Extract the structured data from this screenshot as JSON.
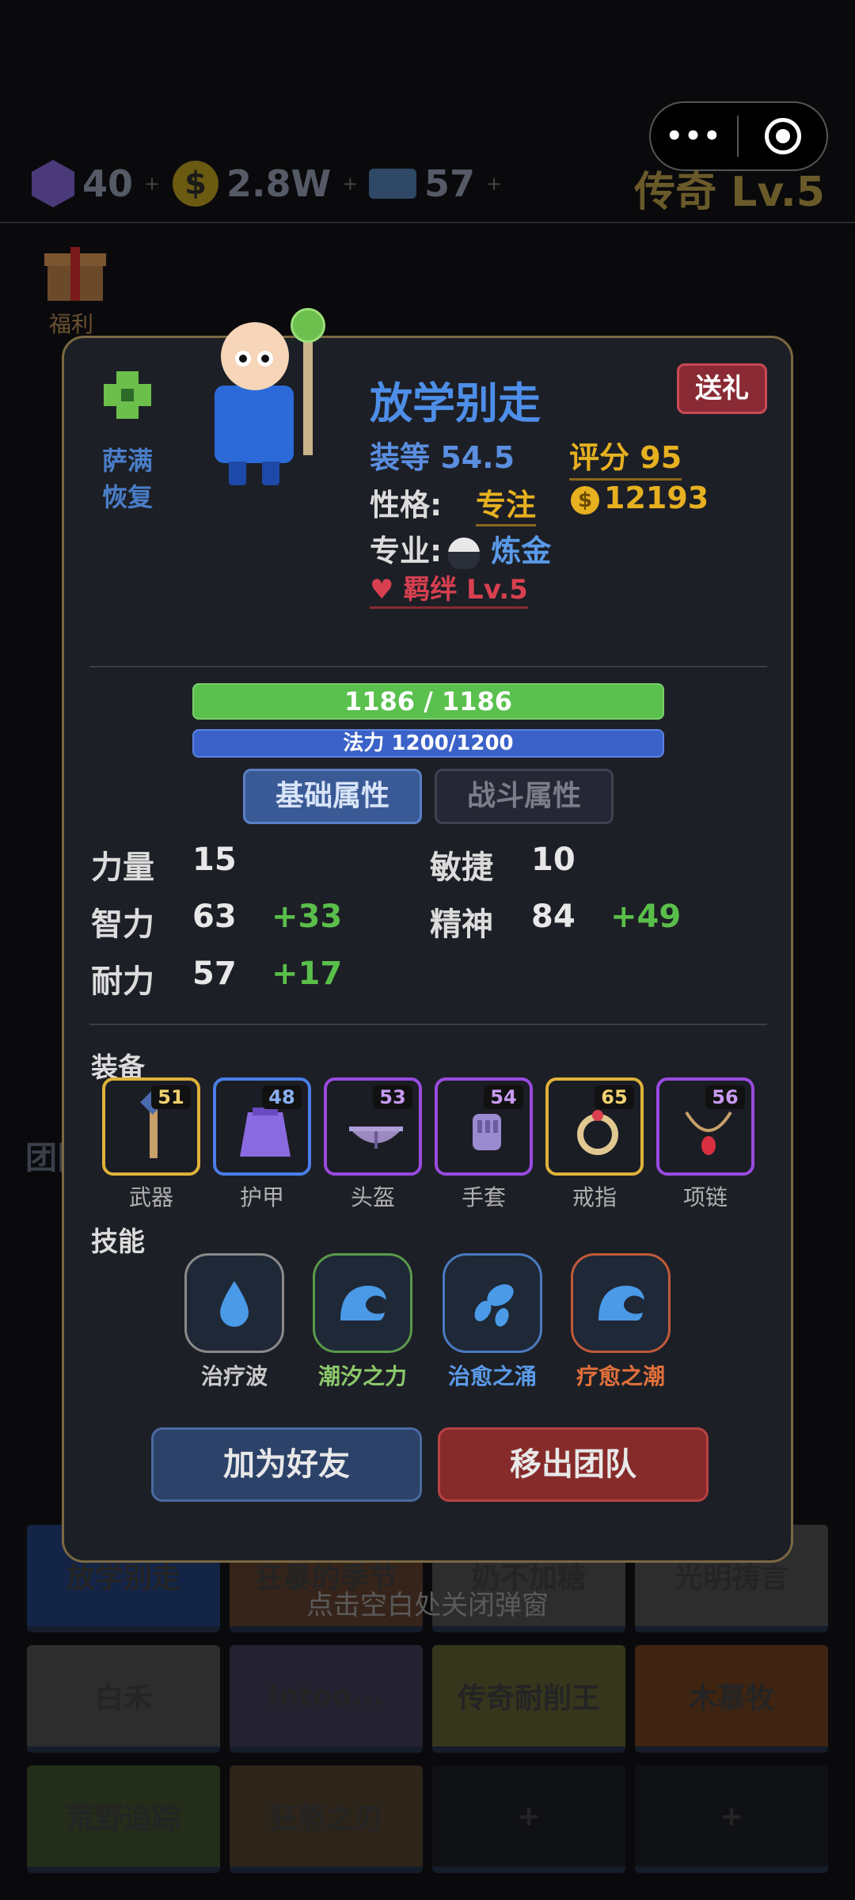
{
  "top": {
    "gems": "40",
    "gold": "2.8W",
    "tickets": "57",
    "plus": "+",
    "coin_glyph": "$",
    "rank": "传奇 Lv.5",
    "capsule_more": "•••"
  },
  "background": {
    "welfare_label": "福利",
    "hint": "点击空白处关闭弹窗",
    "team_header": "团队",
    "tiles": [
      {
        "label": "放学别走",
        "color": "#1b3a78"
      },
      {
        "label": "狂暴的季节",
        "color": "#5a3a26"
      },
      {
        "label": "奶不加糖",
        "color": "#4a4a4a"
      },
      {
        "label": "光明祷言",
        "color": "#4a4a4a"
      },
      {
        "label": "白禾",
        "color": "#4a4a4a"
      },
      {
        "label": "Intoo...",
        "color": "#3a3550"
      },
      {
        "label": "传奇耐削王",
        "color": "#5a5a2a"
      },
      {
        "label": "木慕牧",
        "color": "#6a3a16"
      },
      {
        "label": "荒野追踪",
        "color": "#3a4a26"
      },
      {
        "label": "狂怒之刃",
        "color": "#4a3a26"
      },
      {
        "label": "+",
        "color": "#16181e"
      },
      {
        "label": "+",
        "color": "#16181e"
      }
    ]
  },
  "profile": {
    "class_skill": "萨满\n恢复",
    "class_skill_line1": "萨满",
    "class_skill_line2": "恢复",
    "name": "放学别走",
    "gift_button": "送礼",
    "gear_level_label": "装等",
    "gear_level": "54.5",
    "score_label": "评分",
    "score": "95",
    "personality_label": "性格:",
    "personality": "专注",
    "coin_glyph": "$",
    "coins": "12193",
    "profession_label": "专业:",
    "profession": "炼金",
    "bond": "羁绊 Lv.5",
    "heart": "♥"
  },
  "bars": {
    "hp": "1186 / 1186",
    "mp": "法力 1200/1200",
    "hp_fraction": 1.0,
    "mp_fraction": 1.0
  },
  "tabs": {
    "basic": "基础属性",
    "combat": "战斗属性"
  },
  "stats": [
    {
      "name": "力量",
      "value": "15",
      "bonus": ""
    },
    {
      "name": "敏捷",
      "value": "10",
      "bonus": ""
    },
    {
      "name": "智力",
      "value": "63",
      "bonus": "+33"
    },
    {
      "name": "精神",
      "value": "84",
      "bonus": "+49"
    },
    {
      "name": "耐力",
      "value": "57",
      "bonus": "+17"
    }
  ],
  "equipment": {
    "title": "装备",
    "items": [
      {
        "label": "武器",
        "level": "51",
        "rarity_color": "#e0b23a",
        "icon": "staff-icon"
      },
      {
        "label": "护甲",
        "level": "48",
        "rarity_color": "#4a7ee8",
        "icon": "robe-icon"
      },
      {
        "label": "头盔",
        "level": "53",
        "rarity_color": "#9a4ae0",
        "icon": "helmet-icon"
      },
      {
        "label": "手套",
        "level": "54",
        "rarity_color": "#9a4ae0",
        "icon": "glove-icon"
      },
      {
        "label": "戒指",
        "level": "65",
        "rarity_color": "#e0b23a",
        "icon": "ring-icon"
      },
      {
        "label": "项链",
        "level": "56",
        "rarity_color": "#9a4ae0",
        "icon": "necklace-icon"
      }
    ]
  },
  "skills": {
    "title": "技能",
    "items": [
      {
        "label": "治疗波",
        "color": "#c8c8c8",
        "border": "#8a8a8a",
        "icon": "water-drop-icon"
      },
      {
        "label": "潮汐之力",
        "color": "#8ac86a",
        "border": "#5a9a4a",
        "icon": "wave-icon"
      },
      {
        "label": "治愈之涌",
        "color": "#5a9ae8",
        "border": "#4a7ac0",
        "icon": "splash-icon"
      },
      {
        "label": "疗愈之潮",
        "color": "#e0703a",
        "border": "#c05a3a",
        "icon": "wave-icon"
      }
    ]
  },
  "actions": {
    "add_friend": "加为好友",
    "remove": "移出团队"
  },
  "colors": {
    "accent_blue": "#4d8ee8",
    "gold": "#e6b020",
    "bonus_green": "#5abf4a",
    "modal_border": "#7a6842"
  }
}
